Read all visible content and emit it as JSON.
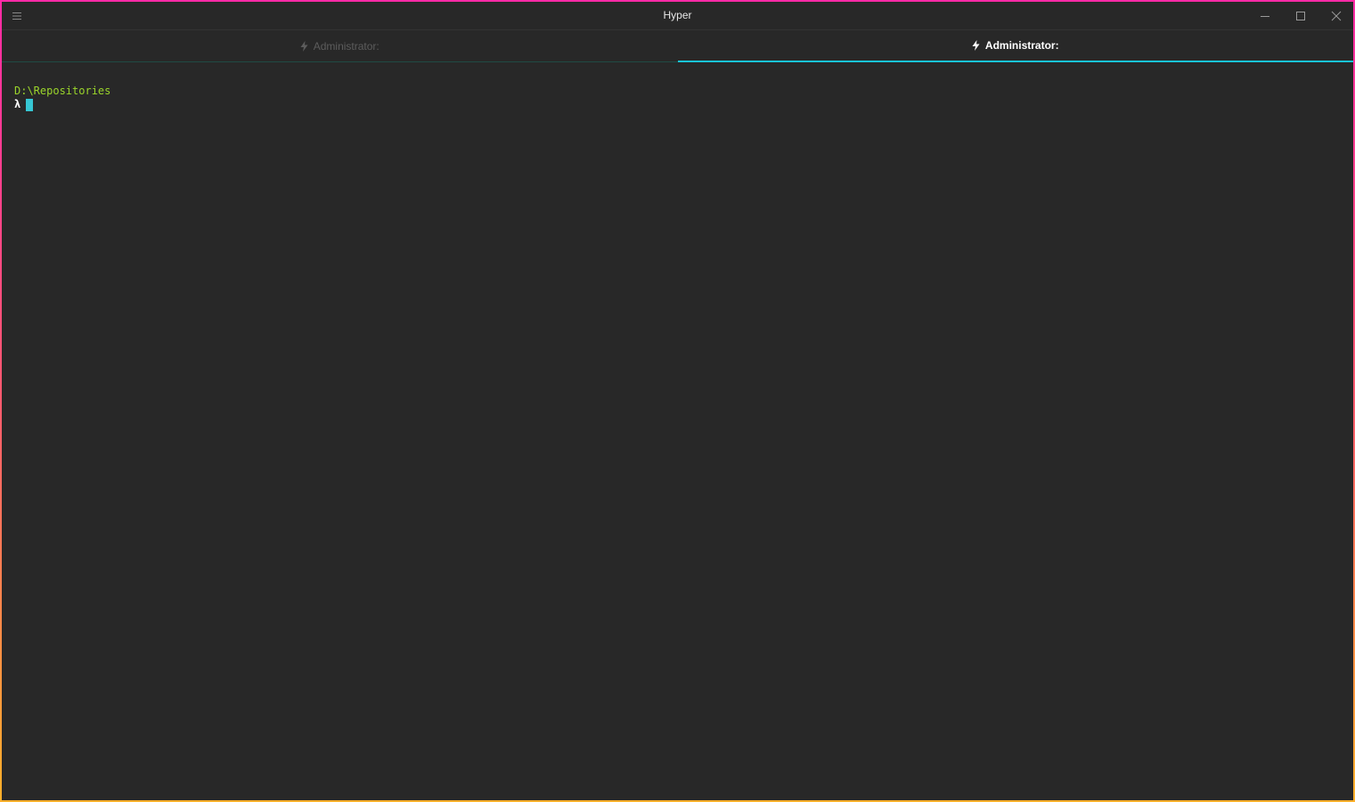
{
  "window": {
    "title": "Hyper",
    "border_gradient": [
      "#ff2aa6",
      "#ff5a6e",
      "#ffb02a"
    ],
    "background": "#282828"
  },
  "titlebar": {
    "menu_icon": "hamburger-icon",
    "controls": {
      "minimize_icon": "minimize-icon",
      "maximize_icon": "maximize-icon",
      "close_icon": "close-icon"
    }
  },
  "tabs": [
    {
      "label": "Administrator:",
      "icon": "bolt-icon",
      "active": false
    },
    {
      "label": "Administrator:",
      "icon": "bolt-icon",
      "active": true
    }
  ],
  "accent_color": "#19c4d6",
  "terminal": {
    "cwd": "D:\\Repositories",
    "prompt_symbol": "λ",
    "input": "",
    "path_color": "#9bd52b",
    "cursor_color": "#36c6d3"
  }
}
